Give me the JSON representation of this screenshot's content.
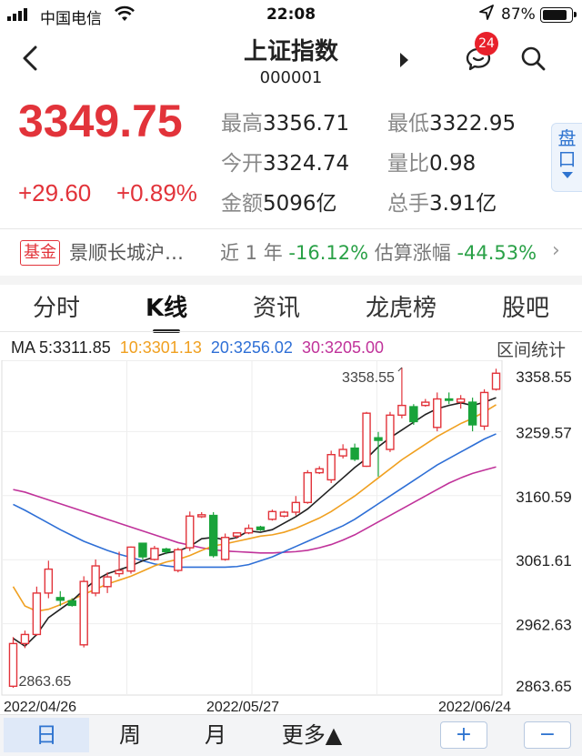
{
  "status_bar": {
    "carrier": "中国电信",
    "time": "22:08",
    "battery": "87%",
    "battery_level": 0.87
  },
  "nav": {
    "title": "上证指数",
    "code": "000001",
    "badge": "24"
  },
  "quote": {
    "price": "3349.75",
    "change": "+29.60",
    "change_pct": "+0.89%",
    "stats": [
      {
        "label": "最高",
        "value": "3356.71"
      },
      {
        "label": "最低",
        "value": "3322.95"
      },
      {
        "label": "今开",
        "value": "3324.74"
      },
      {
        "label": "量比",
        "value": "0.98"
      },
      {
        "label": "金额",
        "value": "5096亿"
      },
      {
        "label": "总手",
        "value": "3.91亿"
      }
    ],
    "pankou_label": "盘口"
  },
  "fund": {
    "tag": "基金",
    "name": "景顺长城沪…",
    "period_label": "近 1 年",
    "period_value": "-16.12%",
    "estimate_label": "估算涨幅",
    "estimate_value": "-44.53%"
  },
  "tabs": [
    "分时",
    "K线",
    "资讯",
    "龙虎榜",
    "股吧"
  ],
  "ma_legend": {
    "ma5": "MA 5:3311.85",
    "ma10": "10:3301.13",
    "ma20": "20:3256.02",
    "ma30": "30:3205.00",
    "interval_label": "区间统计"
  },
  "chart_data": {
    "type": "candlestick",
    "y_ticks": [
      "3358.55",
      "3259.57",
      "3160.59",
      "3061.61",
      "2962.63",
      "2863.65"
    ],
    "ylim": [
      2863.65,
      3358.55
    ],
    "x_labels": [
      "2022/04/26",
      "2022/05/27",
      "2022/06/24"
    ],
    "annotations": {
      "high": "3358.55",
      "low": "2863.65"
    },
    "colors": {
      "up": "#e2333a",
      "down": "#19a33a",
      "ma5": "#222222",
      "ma10": "#f0a020",
      "ma20": "#2e6fd6",
      "ma30": "#c0329a"
    },
    "candles": [
      {
        "o": 2866,
        "h": 2942,
        "l": 2863.65,
        "c": 2932
      },
      {
        "o": 2932,
        "h": 2952,
        "l": 2925,
        "c": 2946
      },
      {
        "o": 2946,
        "h": 3020,
        "l": 2944,
        "c": 3010
      },
      {
        "o": 3010,
        "h": 3060,
        "l": 3002,
        "c": 3047
      },
      {
        "o": 3003,
        "h": 3013,
        "l": 2990,
        "c": 2999
      },
      {
        "o": 2998,
        "h": 3002,
        "l": 2989,
        "c": 2991
      },
      {
        "o": 2930,
        "h": 3036,
        "l": 2926,
        "c": 3028
      },
      {
        "o": 3010,
        "h": 3062,
        "l": 3005,
        "c": 3052
      },
      {
        "o": 3020,
        "h": 3042,
        "l": 3010,
        "c": 3035
      },
      {
        "o": 3040,
        "h": 3074,
        "l": 3035,
        "c": 3045
      },
      {
        "o": 3044,
        "h": 3082,
        "l": 3040,
        "c": 3081
      },
      {
        "o": 3087,
        "h": 3087,
        "l": 3062,
        "c": 3066
      },
      {
        "o": 3062,
        "h": 3083,
        "l": 3060,
        "c": 3079
      },
      {
        "o": 3078,
        "h": 3080,
        "l": 3070,
        "c": 3074
      },
      {
        "o": 3045,
        "h": 3080,
        "l": 3042,
        "c": 3077
      },
      {
        "o": 3080,
        "h": 3136,
        "l": 3075,
        "c": 3129
      },
      {
        "o": 3128,
        "h": 3135,
        "l": 3126,
        "c": 3131
      },
      {
        "o": 3130,
        "h": 3135,
        "l": 3065,
        "c": 3068
      },
      {
        "o": 3062,
        "h": 3102,
        "l": 3060,
        "c": 3096
      },
      {
        "o": 3098,
        "h": 3104,
        "l": 3094,
        "c": 3103
      },
      {
        "o": 3103,
        "h": 3116,
        "l": 3101,
        "c": 3110
      },
      {
        "o": 3112,
        "h": 3114,
        "l": 3106,
        "c": 3108
      },
      {
        "o": 3124,
        "h": 3139,
        "l": 3122,
        "c": 3136
      },
      {
        "o": 3129,
        "h": 3137,
        "l": 3127,
        "c": 3135
      },
      {
        "o": 3135,
        "h": 3160,
        "l": 3130,
        "c": 3150
      },
      {
        "o": 3150,
        "h": 3200,
        "l": 3148,
        "c": 3196
      },
      {
        "o": 3196,
        "h": 3206,
        "l": 3194,
        "c": 3202
      },
      {
        "o": 3185,
        "h": 3230,
        "l": 3180,
        "c": 3224
      },
      {
        "o": 3222,
        "h": 3240,
        "l": 3218,
        "c": 3232
      },
      {
        "o": 3234,
        "h": 3241,
        "l": 3214,
        "c": 3217
      },
      {
        "o": 3206,
        "h": 3290,
        "l": 3205,
        "c": 3288
      },
      {
        "o": 3250,
        "h": 3259,
        "l": 3190,
        "c": 3246
      },
      {
        "o": 3232,
        "h": 3290,
        "l": 3228,
        "c": 3285
      },
      {
        "o": 3285,
        "h": 3358.55,
        "l": 3280,
        "c": 3300
      },
      {
        "o": 3298,
        "h": 3302,
        "l": 3270,
        "c": 3275
      },
      {
        "o": 3300,
        "h": 3310,
        "l": 3298,
        "c": 3305
      },
      {
        "o": 3266,
        "h": 3320,
        "l": 3260,
        "c": 3310
      },
      {
        "o": 3310,
        "h": 3320,
        "l": 3302,
        "c": 3309
      },
      {
        "o": 3305,
        "h": 3316,
        "l": 3295,
        "c": 3310
      },
      {
        "o": 3305,
        "h": 3312,
        "l": 3260,
        "c": 3270
      },
      {
        "o": 3268,
        "h": 3325,
        "l": 3262,
        "c": 3320
      },
      {
        "o": 3325,
        "h": 3356.71,
        "l": 3322.95,
        "c": 3349.75
      }
    ],
    "ma5": [
      2940,
      2928,
      2946,
      2972,
      2985,
      2998,
      3015,
      3030,
      3040,
      3046,
      3052,
      3060,
      3066,
      3072,
      3075,
      3082,
      3094,
      3096,
      3092,
      3096,
      3106,
      3104,
      3108,
      3118,
      3128,
      3140,
      3156,
      3172,
      3188,
      3204,
      3218,
      3236,
      3250,
      3262,
      3274,
      3286,
      3295,
      3300,
      3304,
      3300,
      3305,
      3312
    ],
    "ma10": [
      3020,
      2990,
      2982,
      2985,
      2992,
      3000,
      3008,
      3016,
      3024,
      3030,
      3036,
      3044,
      3052,
      3058,
      3062,
      3068,
      3076,
      3083,
      3086,
      3090,
      3094,
      3098,
      3100,
      3104,
      3110,
      3118,
      3126,
      3136,
      3148,
      3160,
      3174,
      3188,
      3202,
      3216,
      3228,
      3240,
      3252,
      3262,
      3272,
      3280,
      3290,
      3301
    ],
    "ma20": [
      3147,
      3138,
      3128,
      3118,
      3108,
      3099,
      3090,
      3083,
      3076,
      3070,
      3065,
      3060,
      3055,
      3052,
      3050,
      3050,
      3050,
      3050,
      3050,
      3051,
      3054,
      3060,
      3066,
      3074,
      3082,
      3090,
      3098,
      3106,
      3114,
      3124,
      3136,
      3148,
      3160,
      3172,
      3184,
      3196,
      3208,
      3218,
      3228,
      3238,
      3248,
      3256
    ],
    "ma30": [
      3170,
      3166,
      3160,
      3154,
      3148,
      3142,
      3136,
      3130,
      3124,
      3118,
      3112,
      3106,
      3100,
      3094,
      3088,
      3084,
      3080,
      3077,
      3075,
      3074,
      3073,
      3072,
      3072,
      3073,
      3074,
      3076,
      3080,
      3085,
      3092,
      3100,
      3110,
      3120,
      3130,
      3140,
      3150,
      3160,
      3170,
      3180,
      3188,
      3195,
      3200,
      3205
    ]
  },
  "bottom_bar": {
    "tabs": [
      "日",
      "周",
      "月",
      "更多▲"
    ],
    "zoom_in": "+",
    "zoom_out": "−"
  }
}
